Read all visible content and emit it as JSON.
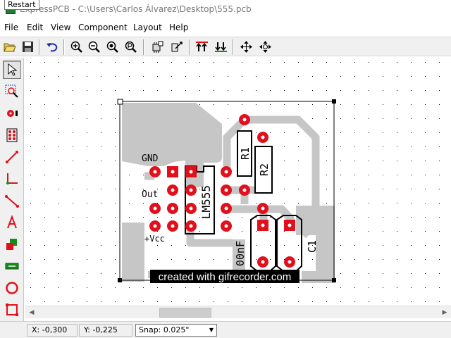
{
  "titlebar": {
    "title": "ExpressPCB - C:\\Users\\Carlos Álvarez\\Desktop\\555.pcb",
    "tooltip": "Restart"
  },
  "menu": {
    "file": "File",
    "edit": "Edit",
    "view": "View",
    "component": "Component",
    "layout": "Layout",
    "help": "Help"
  },
  "board": {
    "silkscreen": {
      "gnd": "GND",
      "out": "Out",
      "vcc": "+Vcc",
      "ic_name": "LM555",
      "r1": "R1",
      "r2": "R2",
      "c_value": "00nF",
      "c1": "C1"
    }
  },
  "watermark": "created with gifrecorder.com",
  "status": {
    "x": "X: -0,300",
    "y": "Y: -0,225",
    "snap_label": "Snap:",
    "snap_value": "0.025\""
  },
  "colors": {
    "pad": "#e0101c",
    "trace": "#c6c6c6",
    "silk": "#000000",
    "grid_dot": "#000000"
  }
}
